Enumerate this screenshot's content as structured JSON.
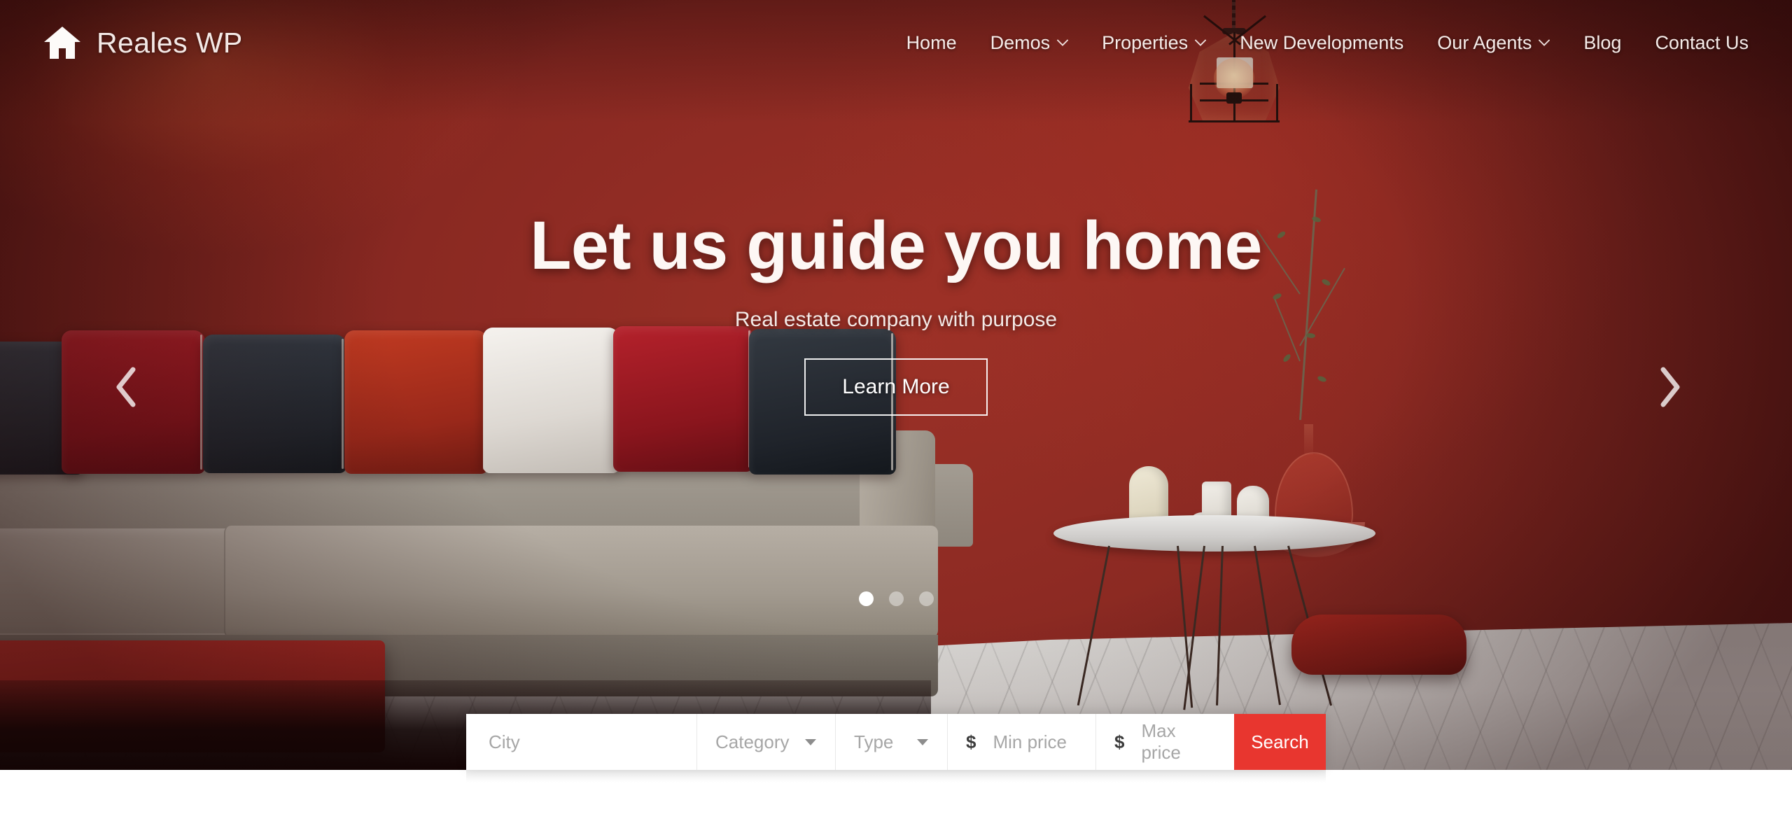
{
  "header": {
    "logo_icon": "house-icon",
    "brand_name": "Reales WP",
    "nav": [
      {
        "label": "Home",
        "has_dropdown": false
      },
      {
        "label": "Demos",
        "has_dropdown": true
      },
      {
        "label": "Properties",
        "has_dropdown": true
      },
      {
        "label": "New Developments",
        "has_dropdown": false
      },
      {
        "label": "Our Agents",
        "has_dropdown": true
      },
      {
        "label": "Blog",
        "has_dropdown": false
      },
      {
        "label": "Contact Us",
        "has_dropdown": false
      }
    ]
  },
  "hero": {
    "title": "Let us guide you home",
    "subtitle": "Real estate company with purpose",
    "cta_label": "Learn More",
    "prev_icon": "chevron-left-icon",
    "next_icon": "chevron-right-icon",
    "slides_total": 3,
    "active_slide": 1
  },
  "search": {
    "city_placeholder": "City",
    "category_label": "Category",
    "type_label": "Type",
    "currency_symbol": "$",
    "min_price_placeholder": "Min price",
    "max_price_placeholder": "Max price",
    "search_label": "Search",
    "dropdown_icon": "caret-down-icon"
  },
  "colors": {
    "accent_red": "#e8362f",
    "wall_red": "#8d2c24",
    "text_light": "#f6ece9",
    "placeholder_grey": "#a6a6a6"
  }
}
